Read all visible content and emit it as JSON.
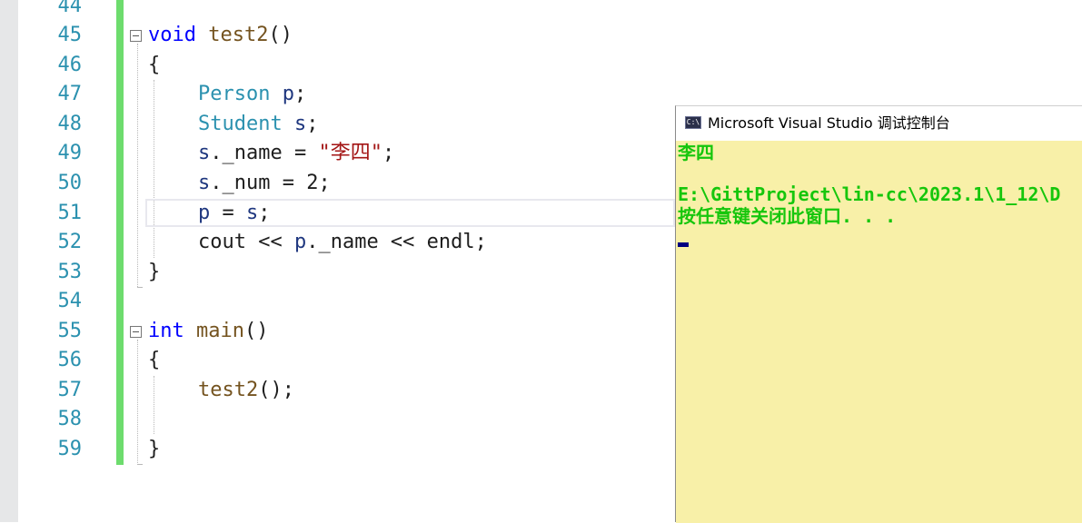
{
  "editor": {
    "line_numbers": [
      "44",
      "45",
      "46",
      "47",
      "48",
      "49",
      "50",
      "51",
      "52",
      "53",
      "54",
      "55",
      "56",
      "57",
      "58",
      "59"
    ],
    "code": {
      "l45": {
        "kw": "void",
        "fn": "test2",
        "rest": "()"
      },
      "l46": "{",
      "l47": {
        "ty": "Person",
        "sp": " ",
        "var": "p",
        "rest": ";"
      },
      "l48": {
        "ty": "Student",
        "sp": " ",
        "var": "s",
        "rest": ";"
      },
      "l49": {
        "var": "s",
        "rest1": "._name = ",
        "str": "\"李四\"",
        "rest2": ";"
      },
      "l50": {
        "var": "s",
        "rest": "._num = 2;"
      },
      "l51": {
        "var1": "p",
        "mid": " = ",
        "var2": "s",
        "rest": ";"
      },
      "l52": {
        "a": "cout << ",
        "var": "p",
        "b": "._name << endl;"
      },
      "l53": "}",
      "l55": {
        "kw": "int",
        "sp": " ",
        "fn": "main",
        "rest": "()"
      },
      "l56": "{",
      "l57": {
        "fn": "test2",
        "rest": "();"
      },
      "l59": "}"
    }
  },
  "console": {
    "title": "Microsoft Visual Studio 调试控制台",
    "icon": "console-icon",
    "icon_text": "C:\\",
    "lines": [
      "李四",
      "",
      "E:\\GittProject\\lin-cc\\2023.1\\1_12\\D",
      "按任意键关闭此窗口. . ."
    ]
  },
  "colors": {
    "keyword": "#0000ff",
    "type": "#2b91af",
    "string": "#a31515",
    "console_text": "#16c60c",
    "console_bg": "#f8f0a8",
    "change_bar": "#6ddc6d"
  }
}
